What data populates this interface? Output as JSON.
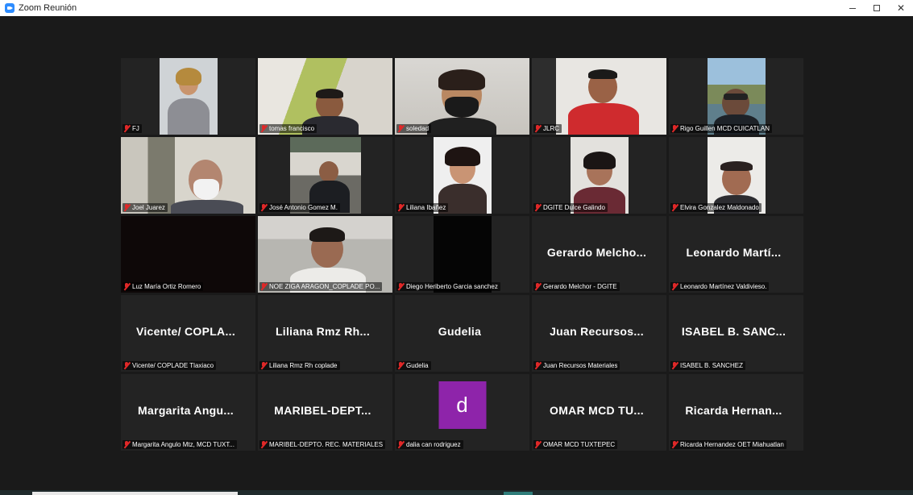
{
  "window": {
    "title": "Zoom Reunión"
  },
  "colors": {
    "mic_muted": "#e02828",
    "avatar_bg": "#8e24aa",
    "tile_bg": "#232323",
    "stage_bg": "#1a1a1a"
  },
  "participants": [
    {
      "label": "FJ",
      "display": ""
    },
    {
      "label": "tomas francisco",
      "display": ""
    },
    {
      "label": "soledad",
      "display": ""
    },
    {
      "label": "JLRC",
      "display": ""
    },
    {
      "label": "Rigo Guillen MCD CUICATLAN",
      "display": ""
    },
    {
      "label": "Joel Juarez",
      "display": ""
    },
    {
      "label": "José Antonio Gomez M.",
      "display": ""
    },
    {
      "label": "Liliana Ibañez",
      "display": ""
    },
    {
      "label": "DGITE Dulce Galindo",
      "display": ""
    },
    {
      "label": "Elvira Gonzalez Maldonado",
      "display": ""
    },
    {
      "label": "Luz María Ortiz Romero",
      "display": ""
    },
    {
      "label": "NOE ZIGA ARAGON_COPLADE PO...",
      "display": ""
    },
    {
      "label": "Diego Heriberto Garcia sanchez",
      "display": ""
    },
    {
      "label": "Gerardo Melchor - DGITE",
      "display": "Gerardo Melcho..."
    },
    {
      "label": "Leonardo Martínez Valdivieso.",
      "display": "Leonardo Martí..."
    },
    {
      "label": "Vicente/ COPLADE Tlaxiaco",
      "display": "Vicente/ COPLA..."
    },
    {
      "label": "Liliana Rmz Rh coplade",
      "display": "Liliana Rmz Rh..."
    },
    {
      "label": "Gudelia",
      "display": "Gudelia"
    },
    {
      "label": "Juan Recursos Materiales",
      "display": "Juan Recursos..."
    },
    {
      "label": "ISABEL B. SANCHEZ",
      "display": "ISABEL B. SANC..."
    },
    {
      "label": "Margarita Angulo Mtz, MCD TUXT...",
      "display": "Margarita Angu..."
    },
    {
      "label": "MARIBEL-DEPTO. REC. MATERIALES",
      "display": "MARIBEL-DEPT..."
    },
    {
      "label": "dalia can rodriguez",
      "display": "",
      "avatar_letter": "d"
    },
    {
      "label": "OMAR MCD TUXTEPEC",
      "display": "OMAR MCD TU..."
    },
    {
      "label": "Ricarda Hernandez OET Miahuatlan",
      "display": "Ricarda Hernan..."
    }
  ]
}
